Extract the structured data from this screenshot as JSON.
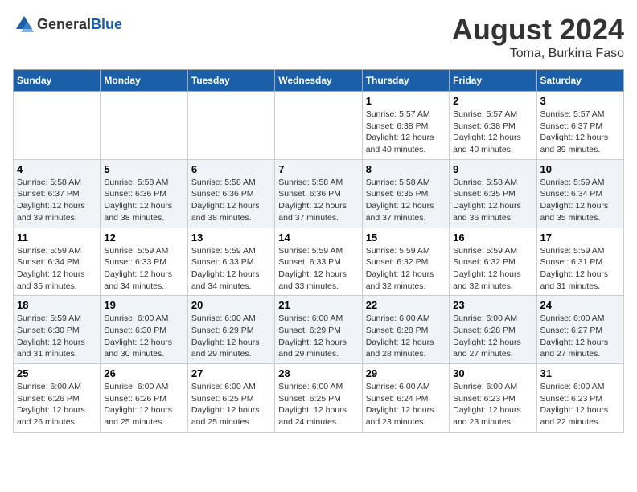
{
  "header": {
    "logo_general": "General",
    "logo_blue": "Blue",
    "month_year": "August 2024",
    "location": "Toma, Burkina Faso"
  },
  "weekdays": [
    "Sunday",
    "Monday",
    "Tuesday",
    "Wednesday",
    "Thursday",
    "Friday",
    "Saturday"
  ],
  "weeks": [
    [
      {
        "day": "",
        "info": ""
      },
      {
        "day": "",
        "info": ""
      },
      {
        "day": "",
        "info": ""
      },
      {
        "day": "",
        "info": ""
      },
      {
        "day": "1",
        "info": "Sunrise: 5:57 AM\nSunset: 6:38 PM\nDaylight: 12 hours\nand 40 minutes."
      },
      {
        "day": "2",
        "info": "Sunrise: 5:57 AM\nSunset: 6:38 PM\nDaylight: 12 hours\nand 40 minutes."
      },
      {
        "day": "3",
        "info": "Sunrise: 5:57 AM\nSunset: 6:37 PM\nDaylight: 12 hours\nand 39 minutes."
      }
    ],
    [
      {
        "day": "4",
        "info": "Sunrise: 5:58 AM\nSunset: 6:37 PM\nDaylight: 12 hours\nand 39 minutes."
      },
      {
        "day": "5",
        "info": "Sunrise: 5:58 AM\nSunset: 6:36 PM\nDaylight: 12 hours\nand 38 minutes."
      },
      {
        "day": "6",
        "info": "Sunrise: 5:58 AM\nSunset: 6:36 PM\nDaylight: 12 hours\nand 38 minutes."
      },
      {
        "day": "7",
        "info": "Sunrise: 5:58 AM\nSunset: 6:36 PM\nDaylight: 12 hours\nand 37 minutes."
      },
      {
        "day": "8",
        "info": "Sunrise: 5:58 AM\nSunset: 6:35 PM\nDaylight: 12 hours\nand 37 minutes."
      },
      {
        "day": "9",
        "info": "Sunrise: 5:58 AM\nSunset: 6:35 PM\nDaylight: 12 hours\nand 36 minutes."
      },
      {
        "day": "10",
        "info": "Sunrise: 5:59 AM\nSunset: 6:34 PM\nDaylight: 12 hours\nand 35 minutes."
      }
    ],
    [
      {
        "day": "11",
        "info": "Sunrise: 5:59 AM\nSunset: 6:34 PM\nDaylight: 12 hours\nand 35 minutes."
      },
      {
        "day": "12",
        "info": "Sunrise: 5:59 AM\nSunset: 6:33 PM\nDaylight: 12 hours\nand 34 minutes."
      },
      {
        "day": "13",
        "info": "Sunrise: 5:59 AM\nSunset: 6:33 PM\nDaylight: 12 hours\nand 34 minutes."
      },
      {
        "day": "14",
        "info": "Sunrise: 5:59 AM\nSunset: 6:33 PM\nDaylight: 12 hours\nand 33 minutes."
      },
      {
        "day": "15",
        "info": "Sunrise: 5:59 AM\nSunset: 6:32 PM\nDaylight: 12 hours\nand 32 minutes."
      },
      {
        "day": "16",
        "info": "Sunrise: 5:59 AM\nSunset: 6:32 PM\nDaylight: 12 hours\nand 32 minutes."
      },
      {
        "day": "17",
        "info": "Sunrise: 5:59 AM\nSunset: 6:31 PM\nDaylight: 12 hours\nand 31 minutes."
      }
    ],
    [
      {
        "day": "18",
        "info": "Sunrise: 5:59 AM\nSunset: 6:30 PM\nDaylight: 12 hours\nand 31 minutes."
      },
      {
        "day": "19",
        "info": "Sunrise: 6:00 AM\nSunset: 6:30 PM\nDaylight: 12 hours\nand 30 minutes."
      },
      {
        "day": "20",
        "info": "Sunrise: 6:00 AM\nSunset: 6:29 PM\nDaylight: 12 hours\nand 29 minutes."
      },
      {
        "day": "21",
        "info": "Sunrise: 6:00 AM\nSunset: 6:29 PM\nDaylight: 12 hours\nand 29 minutes."
      },
      {
        "day": "22",
        "info": "Sunrise: 6:00 AM\nSunset: 6:28 PM\nDaylight: 12 hours\nand 28 minutes."
      },
      {
        "day": "23",
        "info": "Sunrise: 6:00 AM\nSunset: 6:28 PM\nDaylight: 12 hours\nand 27 minutes."
      },
      {
        "day": "24",
        "info": "Sunrise: 6:00 AM\nSunset: 6:27 PM\nDaylight: 12 hours\nand 27 minutes."
      }
    ],
    [
      {
        "day": "25",
        "info": "Sunrise: 6:00 AM\nSunset: 6:26 PM\nDaylight: 12 hours\nand 26 minutes."
      },
      {
        "day": "26",
        "info": "Sunrise: 6:00 AM\nSunset: 6:26 PM\nDaylight: 12 hours\nand 25 minutes."
      },
      {
        "day": "27",
        "info": "Sunrise: 6:00 AM\nSunset: 6:25 PM\nDaylight: 12 hours\nand 25 minutes."
      },
      {
        "day": "28",
        "info": "Sunrise: 6:00 AM\nSunset: 6:25 PM\nDaylight: 12 hours\nand 24 minutes."
      },
      {
        "day": "29",
        "info": "Sunrise: 6:00 AM\nSunset: 6:24 PM\nDaylight: 12 hours\nand 23 minutes."
      },
      {
        "day": "30",
        "info": "Sunrise: 6:00 AM\nSunset: 6:23 PM\nDaylight: 12 hours\nand 23 minutes."
      },
      {
        "day": "31",
        "info": "Sunrise: 6:00 AM\nSunset: 6:23 PM\nDaylight: 12 hours\nand 22 minutes."
      }
    ]
  ]
}
